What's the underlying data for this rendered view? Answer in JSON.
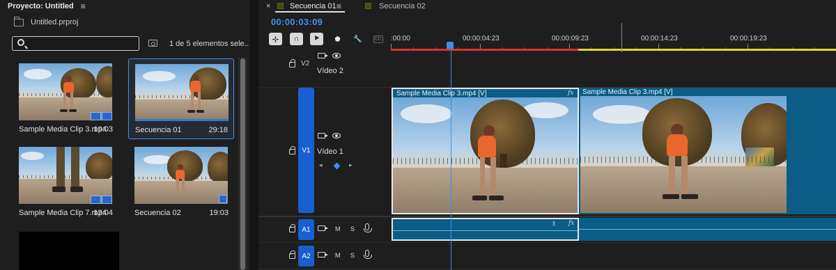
{
  "project": {
    "title": "Proyecto: Untitled",
    "file": "Untitled.prproj",
    "search_value": "",
    "search_placeholder": "",
    "selection_count": "1 de 5 elementos sele...",
    "items": [
      {
        "name": "Sample Media Clip 3.mp4",
        "duration": "19:03",
        "kind": "clip",
        "selected": false
      },
      {
        "name": "Secuencia 01",
        "duration": "29:18",
        "kind": "sequence",
        "selected": true
      },
      {
        "name": "Sample Media Clip 7.mp4",
        "duration": "12:04",
        "kind": "clip",
        "selected": false
      },
      {
        "name": "Secuencia 02",
        "duration": "19:03",
        "kind": "sequence",
        "selected": false
      }
    ]
  },
  "timeline": {
    "tabs": [
      {
        "label": "Secuencia 01",
        "active": true
      },
      {
        "label": "Secuencia 02",
        "active": false
      }
    ],
    "close_glyph": "×",
    "menu_glyph": "≡",
    "timecode": "00:00:03:09",
    "ruler_labels": [
      ":00:00",
      "00:00:04:23",
      "00:00:09:23",
      "00:00:14:23",
      "00:00:19:23"
    ],
    "tools": [
      {
        "icon": "snap-icon",
        "glyph": "⊹"
      },
      {
        "icon": "linked-selection-icon",
        "glyph": "∩"
      },
      {
        "icon": "add-marker-icon",
        "glyph": "⯈"
      },
      {
        "icon": "marker-icon",
        "glyph": "⬟"
      },
      {
        "icon": "wrench-icon",
        "glyph": "🔧"
      },
      {
        "icon": "captions-icon",
        "glyph": "CC"
      }
    ],
    "video_tracks": [
      {
        "id": "V2",
        "name": "Vídeo 2",
        "targeted": false
      },
      {
        "id": "V1",
        "name": "Vídeo 1",
        "targeted": true
      }
    ],
    "audio_tracks": [
      {
        "id": "A1",
        "mute": "M",
        "solo": "S"
      },
      {
        "id": "A2",
        "mute": "M",
        "solo": "S"
      }
    ],
    "clips": [
      {
        "track": "V1",
        "label": "Sample Media Clip 3.mp4 [V]",
        "fx": "fx",
        "selected": true
      },
      {
        "track": "V1",
        "label": "Sample Media Clip 3.mp4 [V]",
        "fx": "",
        "selected": false
      },
      {
        "track": "A1",
        "label": "",
        "fx": "fx",
        "selected": true
      },
      {
        "track": "A1",
        "label": "",
        "fx": "",
        "selected": false
      }
    ],
    "colors": {
      "playhead": "#3f8ee8",
      "timecode": "#3f92ea",
      "track_target": "#1a5fd1",
      "clip": "#0b5c86",
      "work_area_red": "#e0302a",
      "work_area_yellow": "#e6d02a"
    }
  }
}
